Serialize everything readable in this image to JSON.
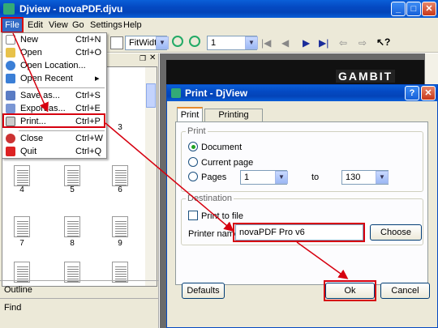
{
  "main_window": {
    "title": "Djview - novaPDF.djvu",
    "menu": [
      "File",
      "Edit",
      "View",
      "Go",
      "Settings",
      "Help"
    ],
    "zoom_value": "FitWidth",
    "page_value": "1",
    "brand_text": "GAMBIT"
  },
  "file_menu": {
    "items": [
      {
        "label": "New",
        "shortcut": "Ctrl+N"
      },
      {
        "label": "Open",
        "shortcut": "Ctrl+O"
      },
      {
        "label": "Open Location...",
        "shortcut": ""
      },
      {
        "label": "Open Recent",
        "shortcut": "▸"
      },
      {
        "label": "Save as...",
        "shortcut": "Ctrl+S"
      },
      {
        "label": "Export as...",
        "shortcut": "Ctrl+E"
      },
      {
        "label": "Print...",
        "shortcut": "Ctrl+P"
      },
      {
        "label": "Close",
        "shortcut": "Ctrl+W"
      },
      {
        "label": "Quit",
        "shortcut": "Ctrl+Q"
      }
    ]
  },
  "sidebar": {
    "page_numbers": [
      "3",
      "4",
      "5",
      "6",
      "7",
      "8",
      "9"
    ],
    "outline_label": "Outline",
    "find_label": "Find"
  },
  "print_dialog": {
    "title": "Print - DjView",
    "tabs": [
      "Print",
      "Printing Options"
    ],
    "print_group": "Print",
    "radio_document": "Document",
    "radio_current": "Current page",
    "radio_pages": "Pages",
    "from_value": "1",
    "to_label": "to",
    "to_value": "130",
    "destination_group": "Destination",
    "print_to_file": "Print to file",
    "printer_name_label": "Printer name:",
    "printer_name_value": "novaPDF Pro v6",
    "choose_label": "Choose",
    "defaults_label": "Defaults",
    "ok_label": "Ok",
    "cancel_label": "Cancel"
  },
  "colors": {
    "highlight_red": "#d6000f",
    "xp_blue": "#0449c2",
    "window_bg": "#ece9d8"
  }
}
